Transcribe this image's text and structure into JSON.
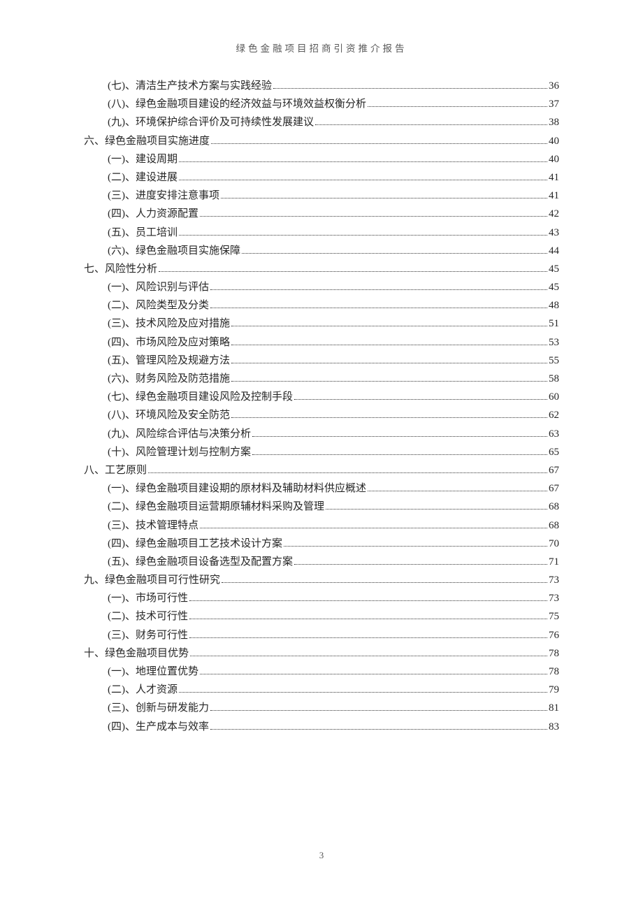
{
  "header": {
    "title": "绿色金融项目招商引资推介报告"
  },
  "footer": {
    "pageNumber": "3"
  },
  "toc": [
    {
      "level": 2,
      "label": "(七)、清洁生产技术方案与实践经验",
      "page": "36"
    },
    {
      "level": 2,
      "label": "(八)、绿色金融项目建设的经济效益与环境效益权衡分析",
      "page": "37"
    },
    {
      "level": 2,
      "label": "(九)、环境保护综合评价及可持续性发展建议",
      "page": "38"
    },
    {
      "level": 1,
      "label": "六、绿色金融项目实施进度",
      "page": "40"
    },
    {
      "level": 2,
      "label": "(一)、建设周期",
      "page": "40"
    },
    {
      "level": 2,
      "label": "(二)、建设进展",
      "page": "41"
    },
    {
      "level": 2,
      "label": "(三)、进度安排注意事项",
      "page": "41"
    },
    {
      "level": 2,
      "label": "(四)、人力资源配置",
      "page": "42"
    },
    {
      "level": 2,
      "label": "(五)、员工培训",
      "page": "43"
    },
    {
      "level": 2,
      "label": "(六)、绿色金融项目实施保障",
      "page": "44"
    },
    {
      "level": 1,
      "label": "七、风险性分析",
      "page": "45"
    },
    {
      "level": 2,
      "label": "(一)、风险识别与评估",
      "page": "45"
    },
    {
      "level": 2,
      "label": "(二)、风险类型及分类",
      "page": "48"
    },
    {
      "level": 2,
      "label": "(三)、技术风险及应对措施",
      "page": "51"
    },
    {
      "level": 2,
      "label": "(四)、市场风险及应对策略",
      "page": "53"
    },
    {
      "level": 2,
      "label": "(五)、管理风险及规避方法",
      "page": "55"
    },
    {
      "level": 2,
      "label": "(六)、财务风险及防范措施",
      "page": "58"
    },
    {
      "level": 2,
      "label": "(七)、绿色金融项目建设风险及控制手段",
      "page": "60"
    },
    {
      "level": 2,
      "label": "(八)、环境风险及安全防范",
      "page": "62"
    },
    {
      "level": 2,
      "label": "(九)、风险综合评估与决策分析",
      "page": "63"
    },
    {
      "level": 2,
      "label": "(十)、风险管理计划与控制方案",
      "page": "65"
    },
    {
      "level": 1,
      "label": "八、工艺原则",
      "page": "67"
    },
    {
      "level": 2,
      "label": "(一)、绿色金融项目建设期的原材料及辅助材料供应概述",
      "page": "67"
    },
    {
      "level": 2,
      "label": "(二)、绿色金融项目运营期原辅材料采购及管理",
      "page": "68"
    },
    {
      "level": 2,
      "label": "(三)、技术管理特点",
      "page": "68"
    },
    {
      "level": 2,
      "label": "(四)、绿色金融项目工艺技术设计方案",
      "page": "70"
    },
    {
      "level": 2,
      "label": "(五)、绿色金融项目设备选型及配置方案",
      "page": "71"
    },
    {
      "level": 1,
      "label": "九、绿色金融项目可行性研究",
      "page": "73"
    },
    {
      "level": 2,
      "label": "(一)、市场可行性",
      "page": "73"
    },
    {
      "level": 2,
      "label": "(二)、技术可行性",
      "page": "75"
    },
    {
      "level": 2,
      "label": "(三)、财务可行性",
      "page": "76"
    },
    {
      "level": 1,
      "label": "十、绿色金融项目优势",
      "page": "78"
    },
    {
      "level": 2,
      "label": "(一)、地理位置优势",
      "page": "78"
    },
    {
      "level": 2,
      "label": "(二)、人才资源",
      "page": "79"
    },
    {
      "level": 2,
      "label": "(三)、创新与研发能力",
      "page": "81"
    },
    {
      "level": 2,
      "label": "(四)、生产成本与效率",
      "page": "83"
    }
  ]
}
